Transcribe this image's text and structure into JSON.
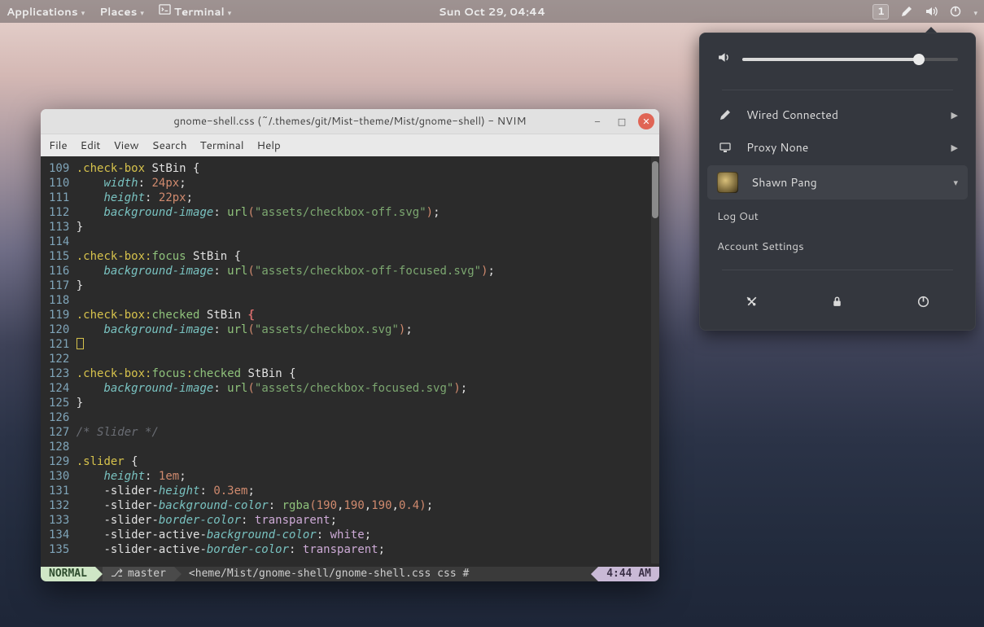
{
  "panel": {
    "applications": "Applications",
    "places": "Places",
    "terminal": "Terminal",
    "clock": "Sun Oct 29, 04:44",
    "workspace": "1"
  },
  "popover": {
    "wired": "Wired Connected",
    "proxy": "Proxy None",
    "user": "Shawn Pang",
    "logout": "Log Out",
    "account_settings": "Account Settings"
  },
  "window": {
    "title": "gnome-shell.css (~/.themes/git/Mist-theme/Mist/gnome-shell) - NVIM",
    "menu": {
      "file": "File",
      "edit": "Edit",
      "view": "View",
      "search": "Search",
      "terminal": "Terminal",
      "help": "Help"
    }
  },
  "code": {
    "lines": [
      {
        "n": "109",
        "html": "<span class='sel'>.check-box</span> StBin {"
      },
      {
        "n": "110",
        "html": "    <span class='prop'>width</span>: <span class='num'>24px</span>;"
      },
      {
        "n": "111",
        "html": "    <span class='prop'>height</span>: <span class='num'>22px</span>;"
      },
      {
        "n": "112",
        "html": "    <span class='prop'>background-image</span>: <span class='func'>url</span><span class='br'>(</span><span class='str'>\"assets/checkbox-off.svg\"</span><span class='br'>)</span>;"
      },
      {
        "n": "113",
        "html": "}"
      },
      {
        "n": "114",
        "html": ""
      },
      {
        "n": "115",
        "html": "<span class='sel'>.check-box</span><span class='pse'>:</span><span class='psec'>focus</span> StBin {"
      },
      {
        "n": "116",
        "html": "    <span class='prop'>background-image</span>: <span class='func'>url</span><span class='br'>(</span><span class='str'>\"assets/checkbox-off-focused.svg\"</span><span class='br'>)</span>;"
      },
      {
        "n": "117",
        "html": "}"
      },
      {
        "n": "118",
        "html": ""
      },
      {
        "n": "119",
        "html": "<span class='sel'>.check-box</span><span class='pse'>:</span><span class='psec'>checked</span> StBin <span class='err'>{</span>"
      },
      {
        "n": "120",
        "html": "    <span class='prop'>background-image</span>: <span class='func'>url</span><span class='br'>(</span><span class='str'>\"assets/checkbox.svg\"</span><span class='br'>)</span>;"
      },
      {
        "n": "121",
        "html": "<span class='cursor-box'></span>"
      },
      {
        "n": "122",
        "html": ""
      },
      {
        "n": "123",
        "html": "<span class='sel'>.check-box</span><span class='pse'>:</span><span class='psec'>focus</span><span class='pse'>:</span><span class='psec'>checked</span> StBin {"
      },
      {
        "n": "124",
        "html": "    <span class='prop'>background-image</span>: <span class='func'>url</span><span class='br'>(</span><span class='str'>\"assets/checkbox-focused.svg\"</span><span class='br'>)</span>;"
      },
      {
        "n": "125",
        "html": "}"
      },
      {
        "n": "126",
        "html": ""
      },
      {
        "n": "127",
        "html": "<span class='cmt'>/* Slider */</span>"
      },
      {
        "n": "128",
        "html": ""
      },
      {
        "n": "129",
        "html": "<span class='sel'>.slider</span> {"
      },
      {
        "n": "130",
        "html": "    <span class='prop'>height</span>: <span class='num'>1em</span>;"
      },
      {
        "n": "131",
        "html": "    -slider-<span class='prop'>height</span>: <span class='num'>0.3em</span>;"
      },
      {
        "n": "132",
        "html": "    -slider-<span class='prop'>background-color</span>: <span class='func'>rgba</span><span class='br'>(</span><span class='num'>190</span>,<span class='num'>190</span>,<span class='num'>190</span>,<span class='num'>0.4</span><span class='br'>)</span>;"
      },
      {
        "n": "133",
        "html": "    -slider-<span class='prop'>border-color</span>: <span class='val'>transparent</span>;"
      },
      {
        "n": "134",
        "html": "    -slider-active-<span class='prop'>background-color</span>: <span class='val'>white</span>;"
      },
      {
        "n": "135",
        "html": "    -slider-active-<span class='prop'>border-color</span>: <span class='val'>transparent</span>;"
      }
    ]
  },
  "status": {
    "mode": "NORMAL",
    "branch": "master",
    "file": "<heme/Mist/gnome-shell/gnome-shell.css    css #",
    "clock": "4:44 AM"
  }
}
